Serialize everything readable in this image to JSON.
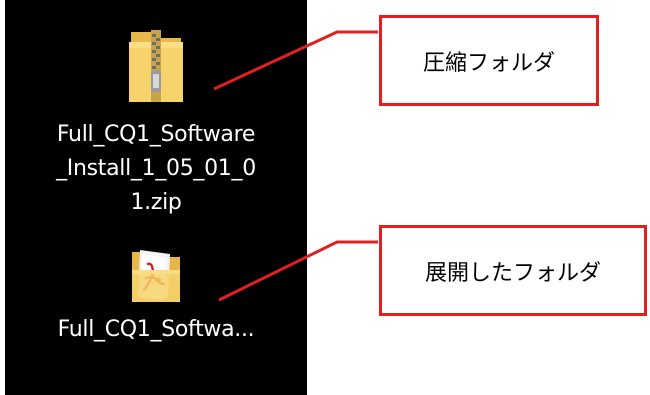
{
  "desktop": {
    "icons": [
      {
        "name_lines": [
          "Full_CQ1_Software",
          "_Install_1_05_01_0",
          "1.zip"
        ],
        "icon": "zip-folder-icon"
      },
      {
        "name_lines": [
          "Full_CQ1_Softwa..."
        ],
        "icon": "pdf-folder-icon"
      }
    ]
  },
  "callouts": [
    {
      "label": "圧縮フォルダ"
    },
    {
      "label": "展開したフォルダ"
    }
  ],
  "colors": {
    "desktop_background": "#000000",
    "callout_border": "#e02020",
    "callout_line": "#e02020",
    "folder_yellow": "#f2c75c"
  }
}
